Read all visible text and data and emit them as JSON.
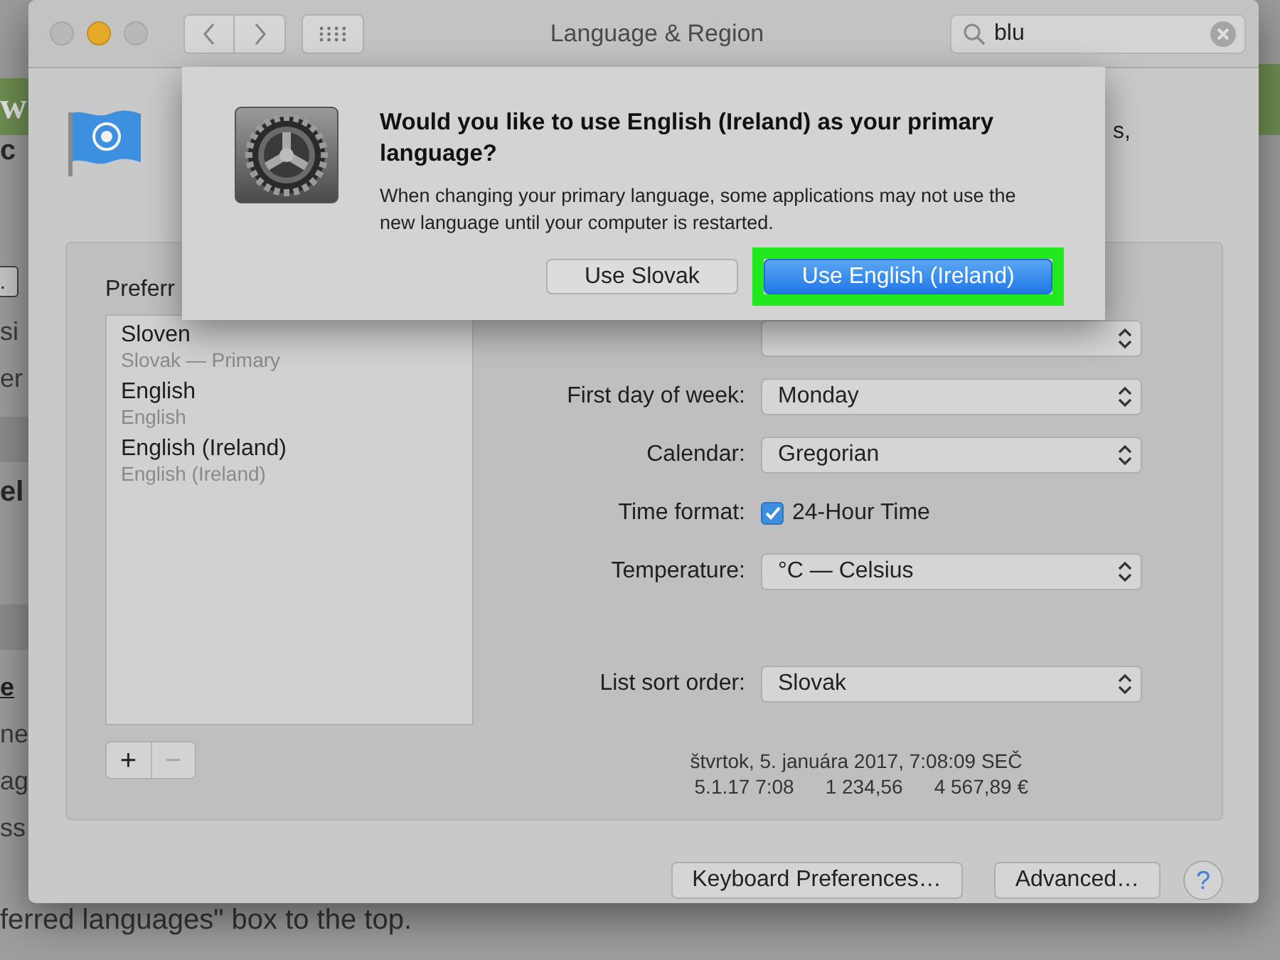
{
  "background_page": {
    "fragments": [
      {
        "kind": "banner",
        "text": "w"
      },
      {
        "kind": "heading",
        "text": "c"
      },
      {
        "kind": "button",
        "text": "."
      },
      {
        "kind": "text",
        "text": "si"
      },
      {
        "kind": "text",
        "text": "er"
      },
      {
        "kind": "bar"
      },
      {
        "kind": "heading",
        "text": "el"
      },
      {
        "kind": "bar"
      },
      {
        "kind": "underlined",
        "text": "e"
      },
      {
        "kind": "text",
        "text": "ne"
      },
      {
        "kind": "text",
        "text": "ag"
      },
      {
        "kind": "text",
        "text": "ss"
      }
    ],
    "bottom_line": "ferred languages\" box to the top."
  },
  "window": {
    "title": "Language & Region",
    "traffic_lights": [
      {
        "kind": "close",
        "active": false
      },
      {
        "kind": "minimize",
        "active": true
      },
      {
        "kind": "zoom",
        "active": false
      }
    ],
    "search": {
      "value": "blu"
    },
    "heading_fragment": "s,",
    "preferred_label": "Preferr",
    "languages": [
      {
        "name": "Sloven",
        "native": "Slovak — Primary"
      },
      {
        "name": "English",
        "native": "English"
      },
      {
        "name": "English (Ireland)",
        "native": "English (Ireland)"
      }
    ],
    "list_buttons": [
      {
        "label": "+",
        "disabled": false
      },
      {
        "label": "−",
        "disabled": true
      }
    ],
    "settings": [
      {
        "kind": "select",
        "label": "First day of week:",
        "value": "Monday"
      },
      {
        "kind": "select",
        "label": "Calendar:",
        "value": "Gregorian"
      },
      {
        "kind": "checkbox",
        "label": "Time format:",
        "value": "24-Hour Time",
        "checked": true
      },
      {
        "kind": "select",
        "label": "Temperature:",
        "value": "°C — Celsius"
      }
    ],
    "sort_settings": [
      {
        "kind": "select",
        "label": "List sort order:",
        "value": "Slovak"
      }
    ],
    "sample": {
      "date": "štvrtok, 5. januára 2017, 7:08:09 SEČ",
      "values": [
        "5.1.17 7:08",
        "1 234,56",
        "4 567,89 €"
      ]
    },
    "footer_buttons": [
      "Keyboard Preferences…",
      "Advanced…"
    ],
    "help": "?"
  },
  "dialog": {
    "title": "Would you like to use English (Ireland) as your primary language?",
    "message": "When changing your primary language, some applications may not use the new language until your computer is restarted.",
    "buttons": [
      {
        "label": "Use Slovak",
        "default": false,
        "highlighted": false
      },
      {
        "label": "Use English (Ireland)",
        "default": true,
        "highlighted": true
      }
    ]
  }
}
